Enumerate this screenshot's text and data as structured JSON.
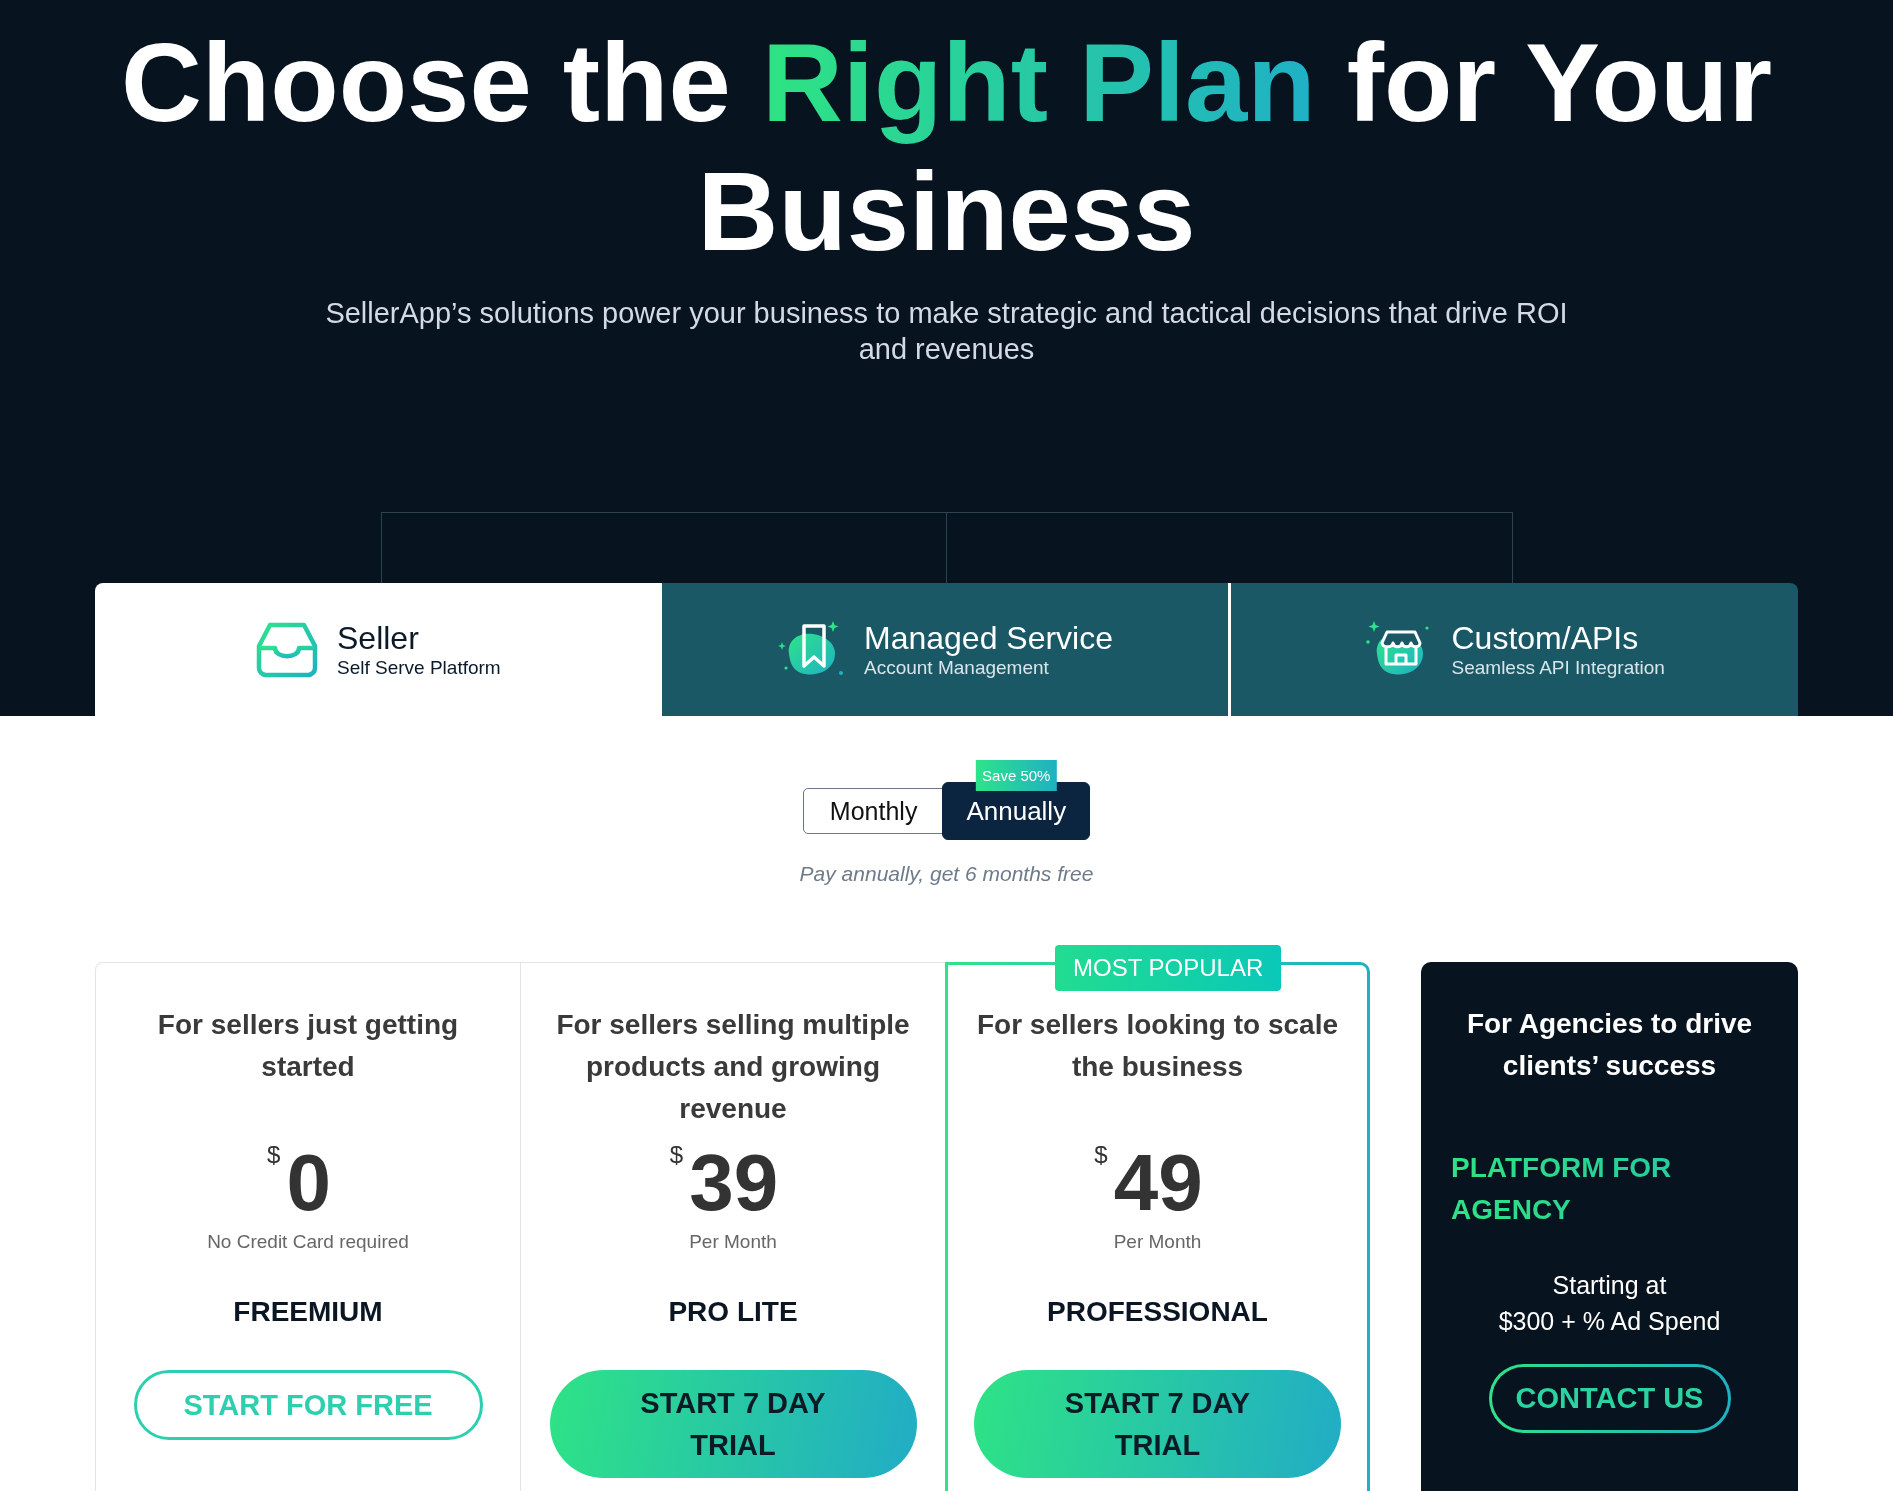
{
  "hero": {
    "title": {
      "before": "Choose the",
      "highlight": "Right Plan",
      "after": "for Your Business"
    },
    "subtitle": "SellerApp’s solutions power your business to make strategic and tactical decisions that drive ROI and revenues"
  },
  "tabs": [
    {
      "label": "Seller",
      "sublabel": "Self Serve Platform",
      "selected": true
    },
    {
      "label": "Managed Service",
      "sublabel": "Account Management",
      "selected": false
    },
    {
      "label": "Custom/APIs",
      "sublabel": "Seamless API Integration",
      "selected": false
    }
  ],
  "billing": {
    "options": [
      {
        "label": "Monthly",
        "selected": false
      },
      {
        "label": "Annually",
        "selected": true,
        "badge": "Save 50%"
      }
    ],
    "note": "Pay annually, get 6 months free"
  },
  "plans": [
    {
      "kind": "standard",
      "featured": false,
      "description": "For sellers just getting started",
      "currency": "$",
      "price": "0",
      "price_note": "No Credit Card required",
      "name": "FREEMIUM",
      "button": "START FOR FREE"
    },
    {
      "kind": "standard",
      "featured": false,
      "description": "For sellers selling multiple products and growing revenue",
      "currency": "$",
      "price": "39",
      "price_note": "Per Month",
      "name": "PRO LITE",
      "button": "START 7 DAY TRIAL"
    },
    {
      "kind": "standard",
      "featured": true,
      "badge": "MOST POPULAR",
      "description": "For sellers looking to scale the business",
      "currency": "$",
      "price": "49",
      "price_note": "Per Month",
      "name": "PROFESSIONAL",
      "button": "START 7 DAY TRIAL"
    },
    {
      "kind": "agency",
      "description": "For Agencies to drive clients’ success",
      "name": "PLATFORM FOR AGENCY",
      "pricing_lines": [
        "Starting at",
        "$300 + % Ad Spend"
      ],
      "button": "CONTACT US"
    }
  ]
}
